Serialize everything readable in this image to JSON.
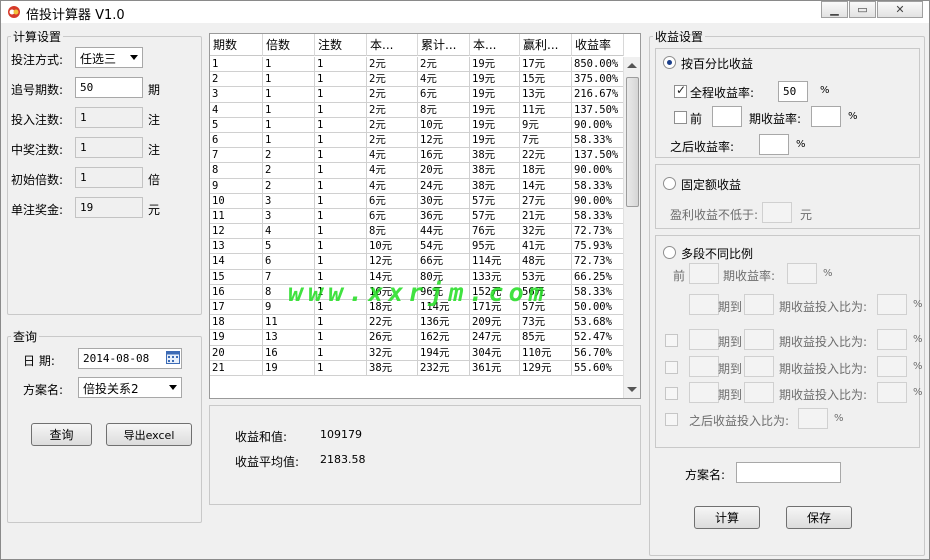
{
  "window": {
    "title": "倍投计算器 V1.0",
    "min": "▁",
    "max": "▭",
    "close": "✕"
  },
  "calc_settings": {
    "legend": "计算设置",
    "bet_mode_label": "投注方式:",
    "bet_mode_value": "任选三",
    "chase_periods_label": "追号期数:",
    "chase_periods_value": "50",
    "chase_periods_unit": "期",
    "bet_count_label": "投入注数:",
    "bet_count_value": "1",
    "bet_count_unit": "注",
    "win_count_label": "中奖注数:",
    "win_count_value": "1",
    "win_count_unit": "注",
    "init_multiple_label": "初始倍数:",
    "init_multiple_value": "1",
    "init_multiple_unit": "倍",
    "prize_label": "单注奖金:",
    "prize_value": "19",
    "prize_unit": "元"
  },
  "query": {
    "legend": "查询",
    "date_label": "日  期:",
    "date_value": "2014-08-08",
    "plan_label": "方案名:",
    "plan_value": "倍投关系2",
    "query_button": "查询",
    "export_button": "导出excel"
  },
  "table": {
    "headers": [
      "期数",
      "倍数",
      "注数",
      "本...",
      "累计...",
      "本...",
      "赢利...",
      "收益率"
    ],
    "rows": [
      [
        "1",
        "1",
        "1",
        "2元",
        "2元",
        "19元",
        "17元",
        "850.00%"
      ],
      [
        "2",
        "1",
        "1",
        "2元",
        "4元",
        "19元",
        "15元",
        "375.00%"
      ],
      [
        "3",
        "1",
        "1",
        "2元",
        "6元",
        "19元",
        "13元",
        "216.67%"
      ],
      [
        "4",
        "1",
        "1",
        "2元",
        "8元",
        "19元",
        "11元",
        "137.50%"
      ],
      [
        "5",
        "1",
        "1",
        "2元",
        "10元",
        "19元",
        "9元",
        "90.00%"
      ],
      [
        "6",
        "1",
        "1",
        "2元",
        "12元",
        "19元",
        "7元",
        "58.33%"
      ],
      [
        "7",
        "2",
        "1",
        "4元",
        "16元",
        "38元",
        "22元",
        "137.50%"
      ],
      [
        "8",
        "2",
        "1",
        "4元",
        "20元",
        "38元",
        "18元",
        "90.00%"
      ],
      [
        "9",
        "2",
        "1",
        "4元",
        "24元",
        "38元",
        "14元",
        "58.33%"
      ],
      [
        "10",
        "3",
        "1",
        "6元",
        "30元",
        "57元",
        "27元",
        "90.00%"
      ],
      [
        "11",
        "3",
        "1",
        "6元",
        "36元",
        "57元",
        "21元",
        "58.33%"
      ],
      [
        "12",
        "4",
        "1",
        "8元",
        "44元",
        "76元",
        "32元",
        "72.73%"
      ],
      [
        "13",
        "5",
        "1",
        "10元",
        "54元",
        "95元",
        "41元",
        "75.93%"
      ],
      [
        "14",
        "6",
        "1",
        "12元",
        "66元",
        "114元",
        "48元",
        "72.73%"
      ],
      [
        "15",
        "7",
        "1",
        "14元",
        "80元",
        "133元",
        "53元",
        "66.25%"
      ],
      [
        "16",
        "8",
        "1",
        "16元",
        "96元",
        "152元",
        "56元",
        "58.33%"
      ],
      [
        "17",
        "9",
        "1",
        "18元",
        "114元",
        "171元",
        "57元",
        "50.00%"
      ],
      [
        "18",
        "11",
        "1",
        "22元",
        "136元",
        "209元",
        "73元",
        "53.68%"
      ],
      [
        "19",
        "13",
        "1",
        "26元",
        "162元",
        "247元",
        "85元",
        "52.47%"
      ],
      [
        "20",
        "16",
        "1",
        "32元",
        "194元",
        "304元",
        "110元",
        "56.70%"
      ],
      [
        "21",
        "19",
        "1",
        "38元",
        "232元",
        "361元",
        "129元",
        "55.60%"
      ]
    ]
  },
  "summary": {
    "sum_label": "收益和值:",
    "sum_value": "109179",
    "avg_label": "收益平均值:",
    "avg_value": "2183.58"
  },
  "watermark": "www.xxrjm.com",
  "profit_settings": {
    "legend": "收益设置",
    "percent": {
      "radio_label": "按百分比收益",
      "full_label": "全程收益率:",
      "full_value": "50",
      "full_unit": "%",
      "front_label": "前",
      "front_period_label": "期收益率:",
      "front_unit": "%",
      "after_label": "之后收益率:",
      "after_unit": "%"
    },
    "fixed": {
      "radio_label": "固定额收益",
      "min_label": "盈利收益不低于:",
      "min_unit": "元"
    },
    "multi": {
      "radio_label": "多段不同比例",
      "front_label": "前",
      "front_period_label": "期收益率:",
      "unit": "%",
      "period_to": "期到",
      "ratio_label": "期收益投入比为:",
      "after_label": "之后收益投入比为:"
    },
    "plan_name_label": "方案名:",
    "calc_button": "计算",
    "save_button": "保存"
  }
}
